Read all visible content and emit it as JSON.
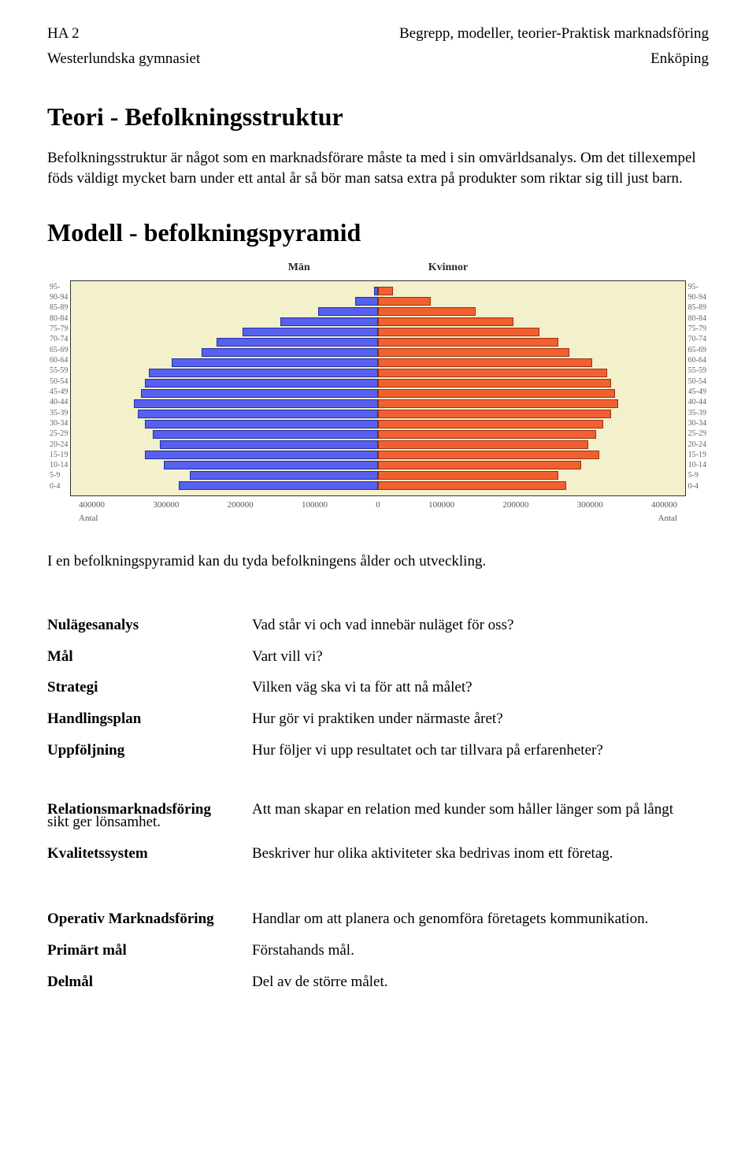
{
  "header": {
    "left_top": "HA 2",
    "right_top": "Begrepp, modeller, teorier-Praktisk marknadsföring",
    "left_sub": "Westerlundska gymnasiet",
    "right_sub": "Enköping"
  },
  "title1": "Teori - Befolkningsstruktur",
  "para1": "Befolkningsstruktur är något som en marknadsförare måste ta med i sin omvärldsanalys. Om det tillexempel föds väldigt mycket barn under ett antal år så bör man satsa extra på produkter som riktar sig till just barn.",
  "title2": "Modell - befolkningspyramid",
  "chart_data": {
    "type": "bar",
    "title": "",
    "left_label": "Män",
    "right_label": "Kvinnor",
    "categories": [
      "95-",
      "90-94",
      "85-89",
      "80-84",
      "75-79",
      "70-74",
      "65-69",
      "60-64",
      "55-59",
      "50-54",
      "45-49",
      "40-44",
      "35-39",
      "30-34",
      "25-29",
      "20-24",
      "15-19",
      "10-14",
      "5-9",
      "0-4"
    ],
    "series": [
      {
        "name": "Män",
        "values": [
          5000,
          30000,
          80000,
          130000,
          180000,
          215000,
          235000,
          275000,
          305000,
          310000,
          315000,
          325000,
          320000,
          310000,
          300000,
          290000,
          310000,
          285000,
          250000,
          265000
        ],
        "color": "#5860f0"
      },
      {
        "name": "Kvinnor",
        "values": [
          20000,
          70000,
          130000,
          180000,
          215000,
          240000,
          255000,
          285000,
          305000,
          310000,
          315000,
          320000,
          310000,
          300000,
          290000,
          280000,
          295000,
          270000,
          240000,
          250000
        ],
        "color": "#f06030"
      }
    ],
    "xlabel_left": "Antal",
    "xlabel_right": "Antal",
    "x_ticks_left": [
      "400000",
      "300000",
      "200000",
      "100000",
      "0"
    ],
    "x_ticks_right": [
      "100000",
      "200000",
      "300000",
      "400000"
    ],
    "x_max": 400000
  },
  "para2": "I en befolkningspyramid kan du tyda befolkningens ålder och utveckling.",
  "pairs1": [
    {
      "term": "Nulägesanalys",
      "def": "Vad står vi och vad innebär nuläget för oss?"
    },
    {
      "term": "Mål",
      "def": "Vart vill vi?"
    },
    {
      "term": "Strategi",
      "def": "Vilken väg ska vi ta för att nå målet?"
    },
    {
      "term": "Handlingsplan",
      "def": "Hur gör vi praktiken under närmaste året?"
    },
    {
      "term": "Uppföljning",
      "def": "Hur följer vi upp resultatet och tar tillvara på erfarenheter?"
    }
  ],
  "rel": {
    "term": "Relationsmarknadsföring",
    "def_line1": "Att man skapar en relation med kunder som håller länger som på långt",
    "def_line2": "sikt ger lönsamhet."
  },
  "kval": {
    "term": "Kvalitetssystem",
    "def": "Beskriver hur olika aktiviteter ska bedrivas inom ett företag."
  },
  "pairs3": [
    {
      "term": "Operativ Marknadsföring",
      "def": "Handlar om att planera och genomföra företagets kommunikation."
    },
    {
      "term": "Primärt mål",
      "def": "Förstahands mål."
    },
    {
      "term": "Delmål",
      "def": "Del av de större målet."
    }
  ]
}
